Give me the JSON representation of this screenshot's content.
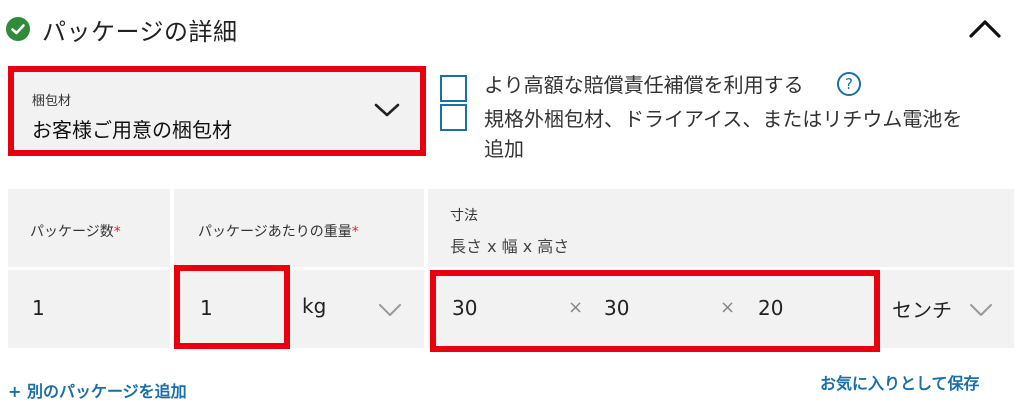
{
  "header": {
    "title": "パッケージの詳細",
    "status_color": "#2f8a3a"
  },
  "packaging": {
    "label": "梱包材",
    "value": "お客様ご用意の梱包材"
  },
  "options": {
    "higher_liability": "より高額な賠償責任補償を利用する",
    "non_standard_line1": "規格外梱包材、ドライアイス、またはリチウム電池を",
    "non_standard_line2": "追加"
  },
  "table": {
    "headers": {
      "package_count": "パッケージ数",
      "weight_per_package": "パッケージあたりの重量",
      "dimensions": "寸法",
      "dimensions_sub": "長さ x 幅 x 高さ",
      "required_mark": "*"
    },
    "row": {
      "package_count": "1",
      "weight": "1",
      "weight_unit": "kg",
      "length": "30",
      "width": "30",
      "height": "20",
      "dimension_separator": "×",
      "dimension_unit": "センチ"
    }
  },
  "footer": {
    "add_package": "+ 別のパッケージを追加",
    "save_favorite": "お気に入りとして保存"
  },
  "colors": {
    "highlight": "#e8000f",
    "accent": "#1a6fa8",
    "select_accent": "#6a2a8e"
  }
}
